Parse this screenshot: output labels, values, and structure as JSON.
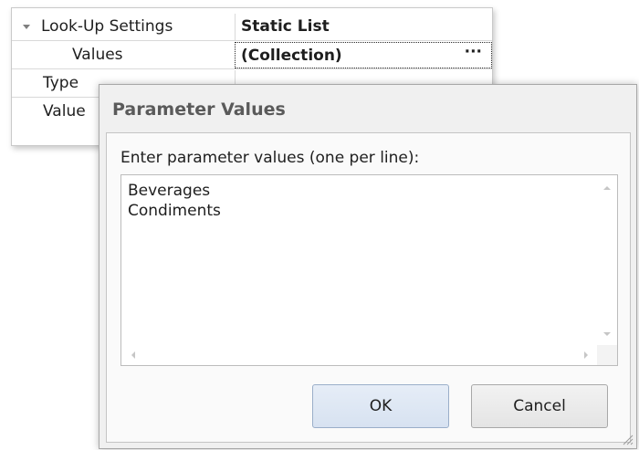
{
  "property_grid": {
    "rows": [
      {
        "name": "Look-Up Settings",
        "value": "Static List",
        "expanded": true
      },
      {
        "name": "Values",
        "value": "(Collection)",
        "button": "···"
      },
      {
        "name": "Type",
        "value": ""
      },
      {
        "name": "Value",
        "value": ""
      }
    ]
  },
  "dialog": {
    "title": "Parameter Values",
    "prompt": "Enter parameter values (one per line):",
    "values": [
      "Beverages",
      "Condiments"
    ],
    "ok_label": "OK",
    "cancel_label": "Cancel"
  },
  "icons": {
    "expander": "triangle-down-icon",
    "scroll_up": "arrow-up-icon",
    "scroll_down": "arrow-down-icon",
    "scroll_left": "arrow-left-icon",
    "scroll_right": "arrow-right-icon",
    "resize": "size-grip-icon"
  },
  "colors": {
    "ok_button": "#d7e2f1",
    "dialog_background": "#f0f0f0",
    "title_text": "#5a5a5a"
  }
}
